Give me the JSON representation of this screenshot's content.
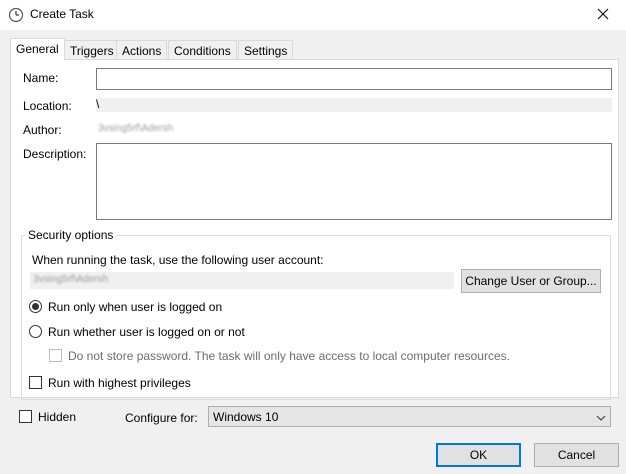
{
  "window": {
    "title": "Create Task",
    "icon": "clock-icon",
    "close_icon": "close-icon"
  },
  "tabs": [
    {
      "label": "General",
      "active": true
    },
    {
      "label": "Triggers",
      "active": false
    },
    {
      "label": "Actions",
      "active": false
    },
    {
      "label": "Conditions",
      "active": false
    },
    {
      "label": "Settings",
      "active": false
    }
  ],
  "general": {
    "name_label": "Name:",
    "name_value": "",
    "location_label": "Location:",
    "location_value": "\\",
    "author_label": "Author:",
    "author_value": "3vsing5rf\\Adersh",
    "description_label": "Description:",
    "description_value": ""
  },
  "security": {
    "title": "Security options",
    "account_prompt": "When running the task, use the following user account:",
    "account_value": "3vsing5rf\\Adersh",
    "change_button": "Change User or Group...",
    "radio_logged_on": "Run only when user is logged on",
    "radio_logged_on_checked": true,
    "radio_whether": "Run whether user is logged on or not",
    "radio_whether_checked": false,
    "no_store_password": "Do not store password.  The task will only have access to local computer resources.",
    "no_store_password_checked": false,
    "highest_privileges": "Run with highest privileges",
    "highest_privileges_checked": false
  },
  "bottom": {
    "hidden_label": "Hidden",
    "hidden_checked": false,
    "configure_label": "Configure for:",
    "configure_value": "Windows 10"
  },
  "buttons": {
    "ok": "OK",
    "cancel": "Cancel"
  },
  "colors": {
    "accent": "#0078d7",
    "panel_bg": "#ffffff",
    "window_bg": "#f0f0f0"
  }
}
